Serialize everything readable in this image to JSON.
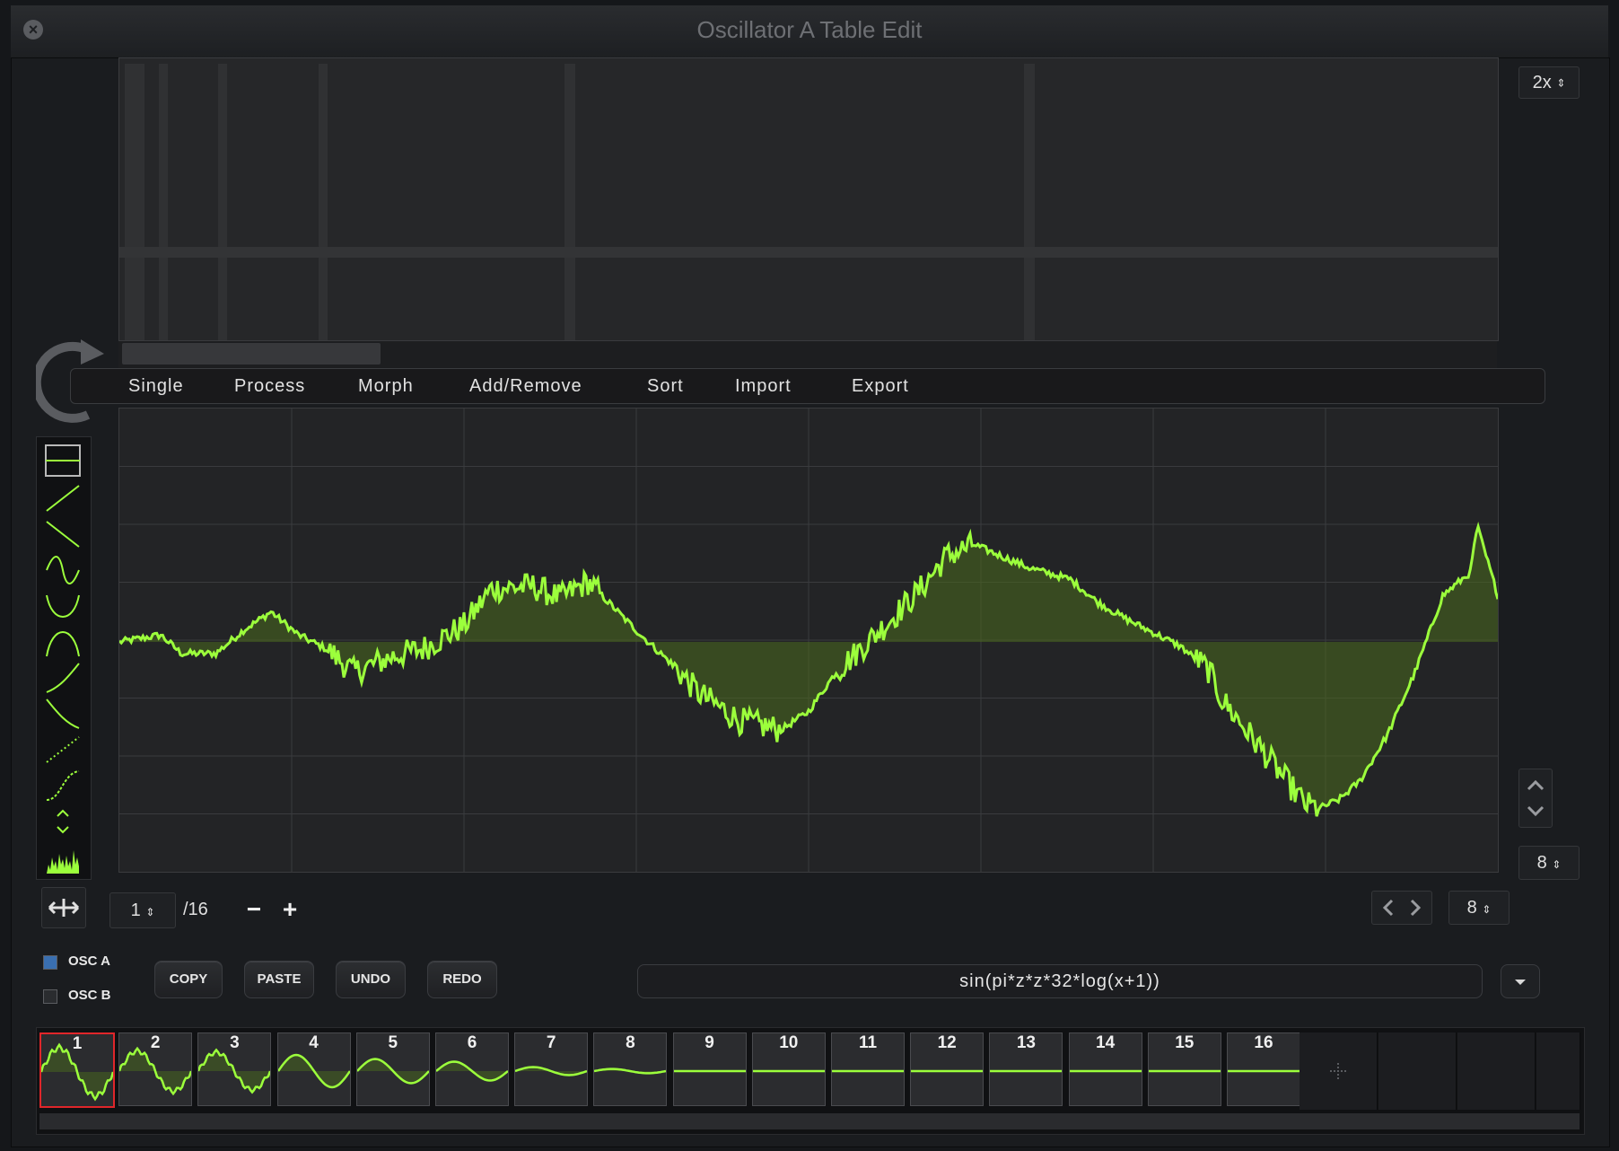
{
  "window": {
    "title": "Oscillator A Table Edit"
  },
  "overview": {
    "zoom": "2x"
  },
  "menu": {
    "items": [
      "Single",
      "Process",
      "Morph",
      "Add/Remove",
      "Sort",
      "Import",
      "Export"
    ]
  },
  "palette": {
    "shapes": [
      "line-icon",
      "ramp-up-icon",
      "ramp-down-icon",
      "sine-icon",
      "sine-inverse-icon",
      "arch-icon",
      "curve-up-icon",
      "curve-down-icon",
      "dotted-ramp-icon",
      "s-curve-icon",
      "bump-icon",
      "noise-icon"
    ]
  },
  "editor": {
    "waveform_color": "#9cff3c",
    "fill_color": "#4a6a1e",
    "grid_cols": 8,
    "grid_rows": 8
  },
  "right_controls": {
    "grid_value": "8",
    "resolution_value": "8"
  },
  "frame_nav": {
    "current": "1",
    "total": "/16",
    "minus": "−",
    "plus": "+"
  },
  "osc": {
    "a_label": "OSC A",
    "b_label": "OSC B",
    "a_checked": true,
    "b_checked": false
  },
  "buttons": {
    "copy": "COPY",
    "paste": "PASTE",
    "undo": "UNDO",
    "redo": "REDO"
  },
  "formula": "sin(pi*z*z*32*log(x+1))",
  "frames": [
    "1",
    "2",
    "3",
    "4",
    "5",
    "6",
    "7",
    "8",
    "9",
    "10",
    "11",
    "12",
    "13",
    "14",
    "15",
    "16"
  ],
  "colors": {
    "accent": "#9cff3c",
    "selected": "#e0262a"
  }
}
